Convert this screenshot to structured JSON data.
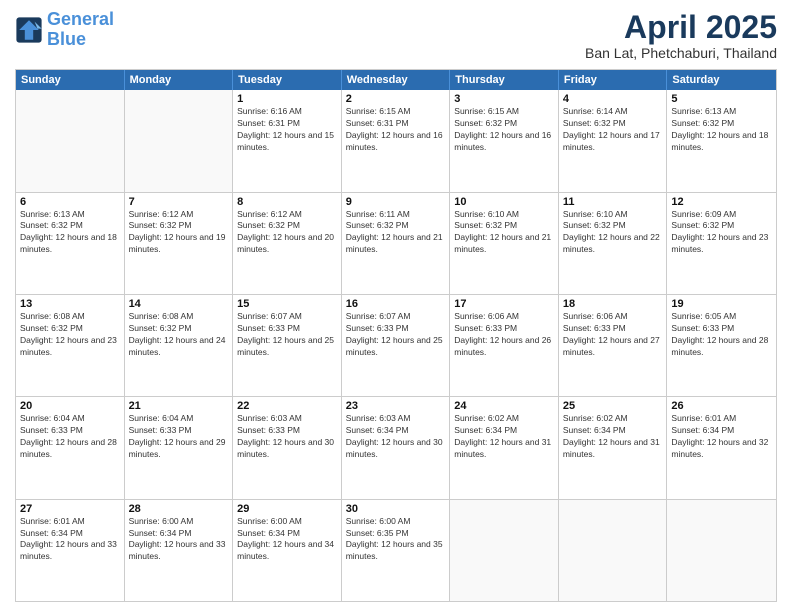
{
  "logo": {
    "line1": "General",
    "line2": "Blue"
  },
  "title": "April 2025",
  "subtitle": "Ban Lat, Phetchaburi, Thailand",
  "header_days": [
    "Sunday",
    "Monday",
    "Tuesday",
    "Wednesday",
    "Thursday",
    "Friday",
    "Saturday"
  ],
  "weeks": [
    [
      {
        "day": "",
        "info": ""
      },
      {
        "day": "",
        "info": ""
      },
      {
        "day": "1",
        "info": "Sunrise: 6:16 AM\nSunset: 6:31 PM\nDaylight: 12 hours and 15 minutes."
      },
      {
        "day": "2",
        "info": "Sunrise: 6:15 AM\nSunset: 6:31 PM\nDaylight: 12 hours and 16 minutes."
      },
      {
        "day": "3",
        "info": "Sunrise: 6:15 AM\nSunset: 6:32 PM\nDaylight: 12 hours and 16 minutes."
      },
      {
        "day": "4",
        "info": "Sunrise: 6:14 AM\nSunset: 6:32 PM\nDaylight: 12 hours and 17 minutes."
      },
      {
        "day": "5",
        "info": "Sunrise: 6:13 AM\nSunset: 6:32 PM\nDaylight: 12 hours and 18 minutes."
      }
    ],
    [
      {
        "day": "6",
        "info": "Sunrise: 6:13 AM\nSunset: 6:32 PM\nDaylight: 12 hours and 18 minutes."
      },
      {
        "day": "7",
        "info": "Sunrise: 6:12 AM\nSunset: 6:32 PM\nDaylight: 12 hours and 19 minutes."
      },
      {
        "day": "8",
        "info": "Sunrise: 6:12 AM\nSunset: 6:32 PM\nDaylight: 12 hours and 20 minutes."
      },
      {
        "day": "9",
        "info": "Sunrise: 6:11 AM\nSunset: 6:32 PM\nDaylight: 12 hours and 21 minutes."
      },
      {
        "day": "10",
        "info": "Sunrise: 6:10 AM\nSunset: 6:32 PM\nDaylight: 12 hours and 21 minutes."
      },
      {
        "day": "11",
        "info": "Sunrise: 6:10 AM\nSunset: 6:32 PM\nDaylight: 12 hours and 22 minutes."
      },
      {
        "day": "12",
        "info": "Sunrise: 6:09 AM\nSunset: 6:32 PM\nDaylight: 12 hours and 23 minutes."
      }
    ],
    [
      {
        "day": "13",
        "info": "Sunrise: 6:08 AM\nSunset: 6:32 PM\nDaylight: 12 hours and 23 minutes."
      },
      {
        "day": "14",
        "info": "Sunrise: 6:08 AM\nSunset: 6:32 PM\nDaylight: 12 hours and 24 minutes."
      },
      {
        "day": "15",
        "info": "Sunrise: 6:07 AM\nSunset: 6:33 PM\nDaylight: 12 hours and 25 minutes."
      },
      {
        "day": "16",
        "info": "Sunrise: 6:07 AM\nSunset: 6:33 PM\nDaylight: 12 hours and 25 minutes."
      },
      {
        "day": "17",
        "info": "Sunrise: 6:06 AM\nSunset: 6:33 PM\nDaylight: 12 hours and 26 minutes."
      },
      {
        "day": "18",
        "info": "Sunrise: 6:06 AM\nSunset: 6:33 PM\nDaylight: 12 hours and 27 minutes."
      },
      {
        "day": "19",
        "info": "Sunrise: 6:05 AM\nSunset: 6:33 PM\nDaylight: 12 hours and 28 minutes."
      }
    ],
    [
      {
        "day": "20",
        "info": "Sunrise: 6:04 AM\nSunset: 6:33 PM\nDaylight: 12 hours and 28 minutes."
      },
      {
        "day": "21",
        "info": "Sunrise: 6:04 AM\nSunset: 6:33 PM\nDaylight: 12 hours and 29 minutes."
      },
      {
        "day": "22",
        "info": "Sunrise: 6:03 AM\nSunset: 6:33 PM\nDaylight: 12 hours and 30 minutes."
      },
      {
        "day": "23",
        "info": "Sunrise: 6:03 AM\nSunset: 6:34 PM\nDaylight: 12 hours and 30 minutes."
      },
      {
        "day": "24",
        "info": "Sunrise: 6:02 AM\nSunset: 6:34 PM\nDaylight: 12 hours and 31 minutes."
      },
      {
        "day": "25",
        "info": "Sunrise: 6:02 AM\nSunset: 6:34 PM\nDaylight: 12 hours and 31 minutes."
      },
      {
        "day": "26",
        "info": "Sunrise: 6:01 AM\nSunset: 6:34 PM\nDaylight: 12 hours and 32 minutes."
      }
    ],
    [
      {
        "day": "27",
        "info": "Sunrise: 6:01 AM\nSunset: 6:34 PM\nDaylight: 12 hours and 33 minutes."
      },
      {
        "day": "28",
        "info": "Sunrise: 6:00 AM\nSunset: 6:34 PM\nDaylight: 12 hours and 33 minutes."
      },
      {
        "day": "29",
        "info": "Sunrise: 6:00 AM\nSunset: 6:34 PM\nDaylight: 12 hours and 34 minutes."
      },
      {
        "day": "30",
        "info": "Sunrise: 6:00 AM\nSunset: 6:35 PM\nDaylight: 12 hours and 35 minutes."
      },
      {
        "day": "",
        "info": ""
      },
      {
        "day": "",
        "info": ""
      },
      {
        "day": "",
        "info": ""
      }
    ]
  ]
}
